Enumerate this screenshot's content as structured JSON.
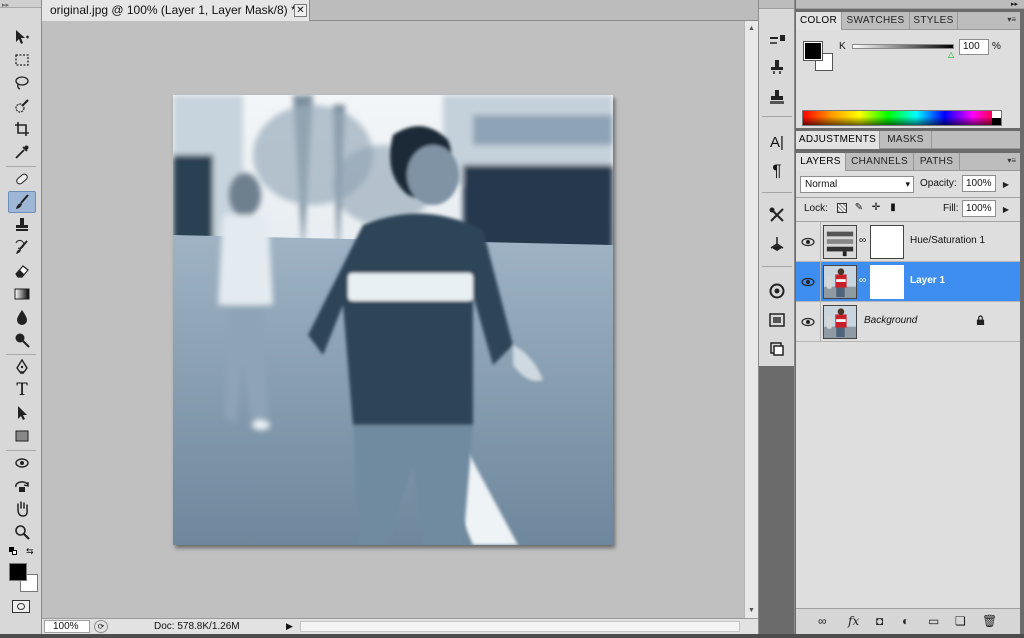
{
  "document": {
    "tab_title": "original.jpg @ 100% (Layer 1, Layer Mask/8) *",
    "close_glyph": "✕"
  },
  "status": {
    "zoom": "100%",
    "doc_info": "Doc: 578.8K/1.26M"
  },
  "tools": [
    "move-tool",
    "marquee-tool",
    "lasso-tool",
    "quick-selection-tool",
    "crop-tool",
    "eyedropper-tool",
    "spot-healing-tool",
    "brush-tool",
    "clone-stamp-tool",
    "history-brush-tool",
    "eraser-tool",
    "gradient-tool",
    "blur-tool",
    "dodge-tool",
    "pen-tool",
    "type-tool",
    "path-selection-tool",
    "rectangle-tool",
    "3d-rotate-tool",
    "3d-orbit-tool",
    "hand-tool",
    "zoom-tool"
  ],
  "active_tool": "brush-tool",
  "type_tool_glyph": "T",
  "dock_icons": [
    "brush-presets-icon",
    "clone-source-icon",
    "tool-presets-icon",
    "character-icon",
    "paragraph-icon",
    "tools-icon",
    "3d-icon",
    "navigator-icon",
    "actions-icon",
    "history-icon"
  ],
  "dock_glyphs": {
    "character": "A|",
    "paragraph": "¶"
  },
  "color_panel": {
    "tabs": [
      "COLOR",
      "SWATCHES",
      "STYLES"
    ],
    "channel_label": "K",
    "channel_value": "100",
    "unit": "%",
    "foreground": "#000000",
    "background": "#ffffff"
  },
  "adjustments_panel": {
    "tabs": [
      "ADJUSTMENTS",
      "MASKS"
    ]
  },
  "layers_panel": {
    "tabs": [
      "LAYERS",
      "CHANNELS",
      "PATHS"
    ],
    "blend_mode": "Normal",
    "opacity_label": "Opacity:",
    "opacity": "100%",
    "lock_label": "Lock:",
    "fill_label": "Fill:",
    "fill": "100%",
    "layers": [
      {
        "name": "Hue/Saturation 1",
        "selected": false
      },
      {
        "name": "Layer 1",
        "selected": true
      },
      {
        "name": "Background",
        "selected": false,
        "locked": true
      }
    ],
    "footer_icons": [
      "link-layers-icon",
      "fx-icon",
      "add-mask-icon",
      "adjustment-layer-icon",
      "new-group-icon",
      "new-layer-icon",
      "delete-layer-icon"
    ],
    "footer_glyphs": {
      "link": "∞",
      "fx": "fx",
      "mask": "◘",
      "adjust": "◐",
      "group": "▭",
      "new": "❏",
      "trash": "🗑"
    }
  },
  "glyphs": {
    "menu": "▾≡",
    "dropdown": "▾",
    "play": "▶",
    "up": "▲",
    "down": "▼",
    "eye": "👁",
    "chain": "∞",
    "lock": "🔒",
    "collapse": "◂◂",
    "expand": "▸▸",
    "slider_thumb": "△"
  },
  "accent": "#3d8ef0"
}
